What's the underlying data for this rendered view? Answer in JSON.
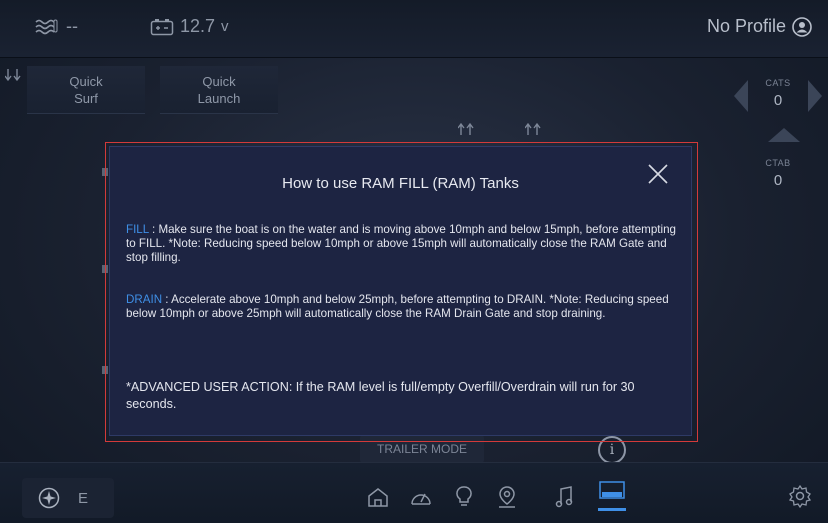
{
  "status": {
    "temp_value": "--",
    "battery_value": "12.7",
    "battery_unit": "v",
    "profile_label": "No Profile"
  },
  "quick_buttons": {
    "surf": "Quick\nSurf",
    "launch": "Quick\nLaunch"
  },
  "right_panels": {
    "cats_label": "CATS",
    "cats_value": "0",
    "ctab_label": "CTAB",
    "ctab_value": "0"
  },
  "modal": {
    "title": "How to use RAM FILL (RAM) Tanks",
    "fill_keyword": "FILL",
    "fill_text": " : Make sure the boat is on the water and is moving above 10mph and below 15mph, before attempting to FILL. *Note: Reducing speed below 10mph or above 15mph will automatically close the RAM Gate and stop filling.",
    "drain_keyword": "DRAIN",
    "drain_text": " : Accelerate above 10mph and below 25mph, before attempting to DRAIN. *Note: Reducing speed below 10mph or above 25mph will automatically close the RAM Drain Gate and stop draining.",
    "advanced_text": "*ADVANCED USER ACTION: If the RAM level is full/empty Overfill/Overdrain will run for 30 seconds."
  },
  "trailer_mode_label": "TRAILER MODE",
  "compass_heading": "E",
  "icons": {
    "temp": "water-temp-icon",
    "battery": "battery-icon",
    "profile": "profile-icon",
    "close": "close-icon",
    "info": "info-icon",
    "compass": "compass-icon",
    "home": "home-icon",
    "gauge": "gauge-icon",
    "lights": "light-bulb-icon",
    "location": "location-icon",
    "music": "music-icon",
    "ballast": "ballast-icon",
    "settings": "gear-icon"
  },
  "colors": {
    "accent_blue": "#3f8fe6",
    "modal_bg": "#1d2442",
    "highlight_red": "#d33a3a"
  }
}
